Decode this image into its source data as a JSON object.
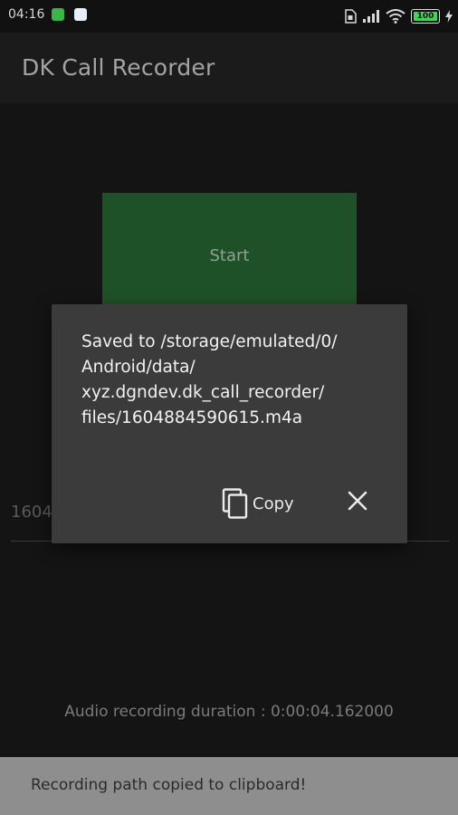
{
  "status_bar": {
    "time": "04:16",
    "battery": "100",
    "icons": [
      "chat-app-icon",
      "calendar-app-icon",
      "sim-icon",
      "signal-icon",
      "wifi-icon",
      "battery-icon",
      "charging-icon"
    ]
  },
  "app_bar": {
    "title": "DK Call Recorder"
  },
  "main": {
    "start_label": "Start",
    "filename_partial": "1604",
    "duration_text": "Audio recording duration : 0:00:04.162000"
  },
  "dialog": {
    "message": "Saved to /storage/emulated/0/Android/data/xyz.dgndev.dk_call_recorder/files/1604884590615.m4a",
    "message_lines": [
      "Saved to /storage/emulated/0/",
      "Android/data/",
      "xyz.dgndev.dk_call_recorder/",
      "files/1604884590615.m4a"
    ],
    "copy_label": "Copy",
    "close_icon": "close-icon"
  },
  "snackbar": {
    "text": "Recording path copied to clipboard!"
  },
  "colors": {
    "start_button": "#1f5128",
    "dialog_bg": "#3b3b3b",
    "snackbar_bg": "#8e8e8e",
    "battery_fill": "#44d35a"
  }
}
